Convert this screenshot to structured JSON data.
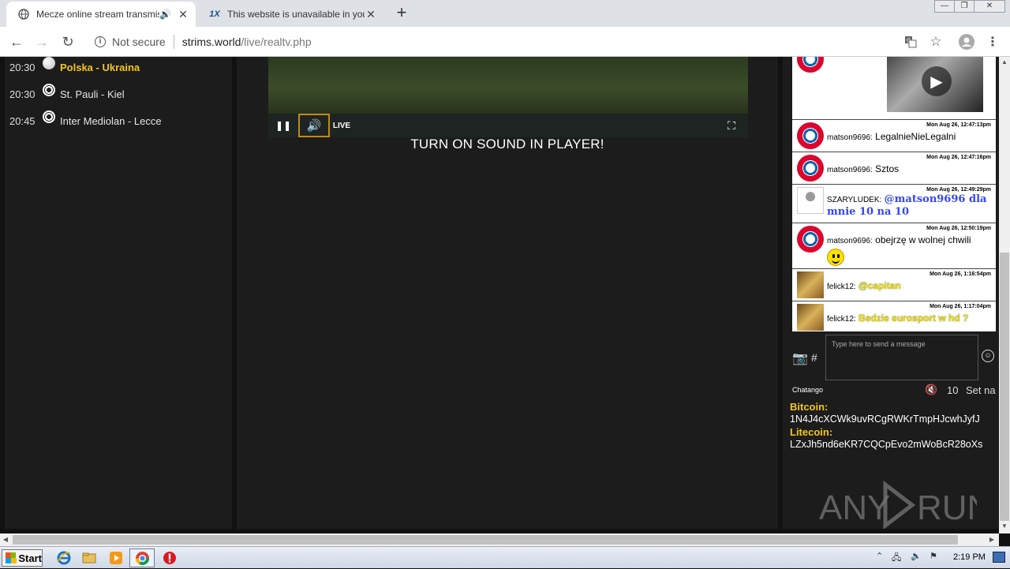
{
  "browser": {
    "tabs": [
      {
        "title": "Mecze online stream transmisje",
        "favicon": "globe-icon",
        "audio": true
      },
      {
        "title": "This website is unavailable in your co",
        "favicon": "1x-logo"
      }
    ],
    "new_tab": "+",
    "window_controls": [
      "—",
      "❐",
      "✕"
    ],
    "address": {
      "security_label": "Not secure",
      "host": "strims.world",
      "path": "/live/realtv.php"
    }
  },
  "matches": [
    {
      "time": "20:30",
      "name": "Polska - Ukraina",
      "highlight": true,
      "icon": "white-ball-icon"
    },
    {
      "time": "20:30",
      "name": "St. Pauli - Kiel",
      "highlight": false,
      "icon": "soccer-ball-icon"
    },
    {
      "time": "20:45",
      "name": "Inter Mediolan - Lecce",
      "highlight": false,
      "icon": "soccer-ball-icon"
    }
  ],
  "player": {
    "live_label": "LIVE",
    "notice": "TURN ON SOUND IN PLAYER!"
  },
  "chat": {
    "messages": [
      {
        "user": "matson9696:",
        "text": "LegalnieNieLegalni",
        "timestamp": "Mon Aug 26, 12:47:13pm",
        "avatar": "bayern"
      },
      {
        "user": "matson9696:",
        "text": "Sztos",
        "timestamp": "Mon Aug 26, 12:47:16pm",
        "avatar": "bayern"
      },
      {
        "user": "SZARYLUDEK:",
        "text": "@matson9696 dla mnie 10 na 10",
        "timestamp": "Mon Aug 26, 12:49:29pm",
        "avatar": "szary"
      },
      {
        "user": "matson9696:",
        "text": "obejrzę w wolnej chwili",
        "timestamp": "Mon Aug 26, 12:50:19pm",
        "avatar": "bayern"
      },
      {
        "user": "felick12:",
        "text": "@capitan",
        "timestamp": "Mon Aug 26, 1:16:54pm",
        "avatar": "felick"
      },
      {
        "user": "felick12:",
        "text": "Bedzie eurosport w hd ?",
        "timestamp": "Mon Aug 26, 1:17:04pm",
        "avatar": "felick"
      }
    ],
    "input_placeholder": "Type here to send a message",
    "hash": "#",
    "brand": "Chatango",
    "user_count": "10",
    "set_name": "Set na"
  },
  "donate": {
    "bitcoin_label": "Bitcoin:",
    "bitcoin_address": "1N4J4cXCWk9uvRCgRWKrTmpHJcwhJyfJ",
    "litecoin_label": "Litecoin:",
    "litecoin_address": "LZxJh5nd6eKR7CQCpEvo2mWoBcR28oXs"
  },
  "watermark": "ANY RUN",
  "taskbar": {
    "start_label": "Start",
    "clock": "2:19 PM"
  },
  "colors": {
    "highlight": "#f5c518",
    "mention_blue": "#3344ff",
    "yellow_text": "#f5e60a",
    "panel_bg": "#1c1c1c"
  }
}
